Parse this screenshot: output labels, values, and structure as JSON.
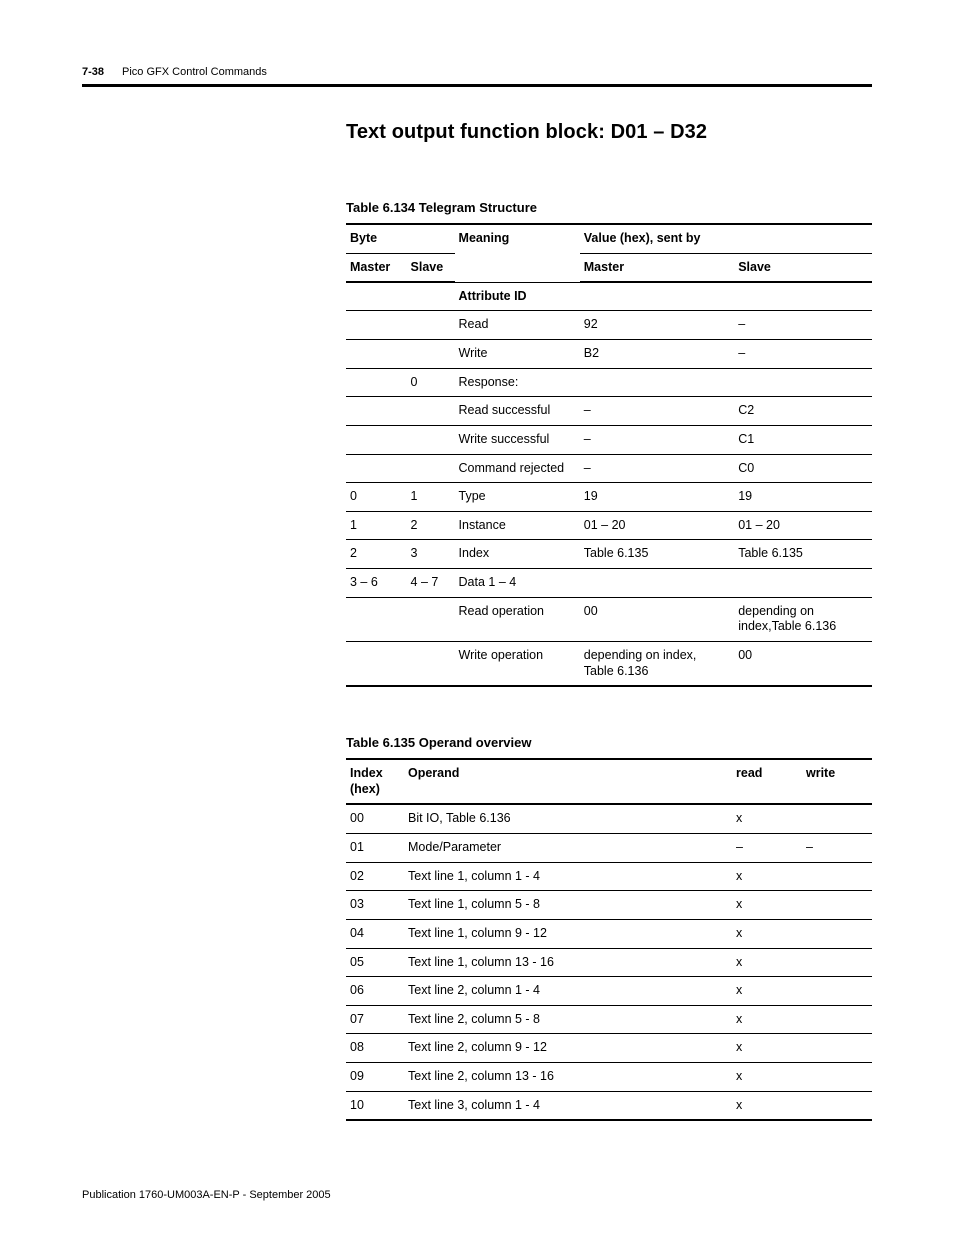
{
  "header": {
    "page_number": "7-38",
    "chapter": "Pico GFX Control Commands"
  },
  "title": "Text output function block: D01 – D32",
  "table134": {
    "caption": "Table 6.134 Telegram Structure",
    "head": {
      "byte": "Byte",
      "meaning": "Meaning",
      "value": "Value (hex), sent by",
      "master_sub": "Master",
      "slave_sub": "Slave",
      "master_col": "Master",
      "slave_col": "Slave"
    },
    "rows": [
      {
        "m": "",
        "s": "",
        "meaning": "Attribute ID",
        "vm": "",
        "vs": "",
        "bold_meaning": true
      },
      {
        "m": "",
        "s": "",
        "meaning": "Read",
        "vm": "92",
        "vs": "–",
        "bold_vm": true
      },
      {
        "m": "",
        "s": "",
        "meaning": "Write",
        "vm": "B2",
        "vs": "–",
        "bold_vm": true
      },
      {
        "m": "",
        "s": "0",
        "meaning": "Response:",
        "vm": "",
        "vs": ""
      },
      {
        "m": "",
        "s": "",
        "meaning": "Read successful",
        "vm": "–",
        "vs": "C2"
      },
      {
        "m": "",
        "s": "",
        "meaning": "Write successful",
        "vm": "–",
        "vs": "C1"
      },
      {
        "m": "",
        "s": "",
        "meaning": "Command rejected",
        "vm": "–",
        "vs": "C0"
      },
      {
        "m": "0",
        "s": "1",
        "meaning": "Type",
        "vm": "19",
        "vs": "19"
      },
      {
        "m": "1",
        "s": "2",
        "meaning": "Instance",
        "vm": "01 – 20",
        "vs": "01 – 20"
      },
      {
        "m": "2",
        "s": "3",
        "meaning": "Index",
        "vm": "Table 6.135",
        "vs": "Table 6.135"
      },
      {
        "m": "3 – 6",
        "s": "4 – 7",
        "meaning": "Data 1 – 4",
        "vm": "",
        "vs": ""
      },
      {
        "m": "",
        "s": "",
        "meaning": "Read operation",
        "vm": "00",
        "vs": "depending on index,Table 6.136"
      },
      {
        "m": "",
        "s": "",
        "meaning": "Write operation",
        "vm": "depending on index, Table 6.136",
        "vs": "00"
      }
    ]
  },
  "table135": {
    "caption": "Table 6.135 Operand overview",
    "head": {
      "index": "Index (hex)",
      "operand": "Operand",
      "read": "read",
      "write": "write"
    },
    "rows": [
      {
        "idx": "00",
        "op": "Bit IO, Table 6.136",
        "r": "x",
        "w": ""
      },
      {
        "idx": "01",
        "op": "Mode/Parameter",
        "r": "–",
        "w": "–"
      },
      {
        "idx": "02",
        "op": "Text line 1, column 1 - 4",
        "r": "x",
        "w": ""
      },
      {
        "idx": "03",
        "op": "Text line 1, column 5 - 8",
        "r": "x",
        "w": ""
      },
      {
        "idx": "04",
        "op": "Text line 1, column 9 - 12",
        "r": "x",
        "w": ""
      },
      {
        "idx": "05",
        "op": "Text line 1, column 13 - 16",
        "r": "x",
        "w": ""
      },
      {
        "idx": "06",
        "op": "Text line 2, column 1 - 4",
        "r": "x",
        "w": ""
      },
      {
        "idx": "07",
        "op": "Text line 2, column 5 - 8",
        "r": "x",
        "w": ""
      },
      {
        "idx": "08",
        "op": "Text line 2, column 9 - 12",
        "r": "x",
        "w": ""
      },
      {
        "idx": "09",
        "op": "Text line 2, column 13 - 16",
        "r": "x",
        "w": ""
      },
      {
        "idx": "10",
        "op": "Text line 3, column 1 - 4",
        "r": "x",
        "w": ""
      }
    ]
  },
  "footer": "Publication 1760-UM003A-EN-P - September 2005"
}
